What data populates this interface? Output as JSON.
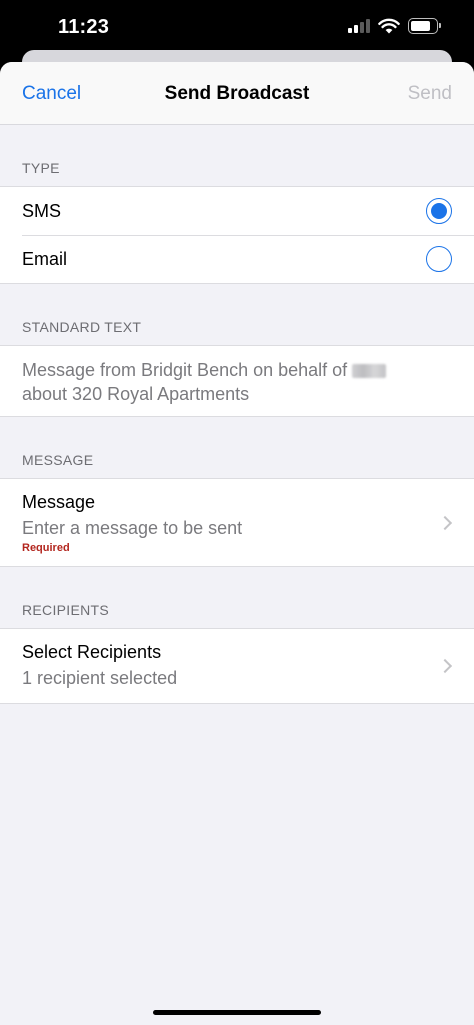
{
  "status_bar": {
    "time": "11:23"
  },
  "nav": {
    "cancel_label": "Cancel",
    "title": "Send Broadcast",
    "send_label": "Send"
  },
  "type_section": {
    "header": "TYPE",
    "options": [
      {
        "label": "SMS",
        "selected": true
      },
      {
        "label": "Email",
        "selected": false
      }
    ]
  },
  "standard_text_section": {
    "header": "STANDARD TEXT",
    "line1": "Message from Bridgit Bench on behalf of",
    "line2": "about 320 Royal Apartments"
  },
  "message_section": {
    "header": "MESSAGE",
    "title": "Message",
    "placeholder": "Enter a message to be sent",
    "required_label": "Required"
  },
  "recipients_section": {
    "header": "RECIPIENTS",
    "title": "Select Recipients",
    "summary": "1 recipient selected"
  },
  "colors": {
    "accent": "#1a73e8",
    "disabled": "#bfbfc4",
    "error": "#b3261e"
  }
}
